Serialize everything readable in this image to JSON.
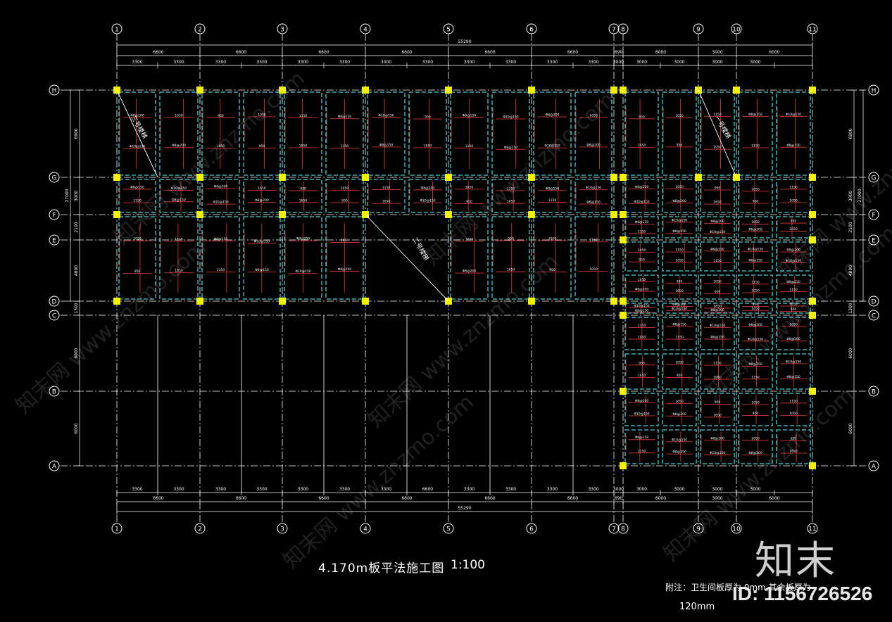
{
  "drawing": {
    "title": "4.170m板平法施工图",
    "scale": "1:100",
    "note_line1": "附注：卫生间板厚为 0mm,其余板厚为",
    "note_line2": "120mm",
    "total_length": "55290",
    "col_labels": [
      "1",
      "2",
      "3",
      "4",
      "5",
      "6",
      "7",
      "8",
      "9",
      "10",
      "11"
    ],
    "row_labels": [
      "H",
      "G",
      "F",
      "E",
      "D",
      "C",
      "B",
      "A"
    ],
    "top_spans": [
      "6600",
      "6600",
      "6600",
      "6600",
      "6600",
      "6600",
      "690",
      "6000",
      "3000",
      "6000"
    ],
    "top_sub_spans": [
      "3300",
      "3300",
      "3300",
      "3300",
      "3300",
      "3300",
      "3300",
      "3300",
      "3300",
      "3300",
      "3300",
      "3300",
      "3000",
      "3000",
      "3000",
      "3000",
      "3000"
    ],
    "bottom_spans": [
      "6600",
      "6600",
      "6600",
      "6600",
      "6600",
      "6600",
      "690",
      "6000",
      "3000",
      "6000"
    ],
    "bottom_sub_spans": [
      "3300",
      "3300",
      "3300",
      "3300",
      "3300",
      "3300",
      "3300",
      "6600",
      "3300",
      "3300",
      "3300",
      "3300",
      "3000",
      "3000",
      "3000",
      "3000",
      "3000"
    ],
    "left_dims": [
      "6900",
      "3000",
      "2100",
      "4800",
      "1300",
      "6000",
      "6000"
    ],
    "left_total": "27000",
    "right_dims": [
      "6900",
      "3000",
      "2100",
      "4800",
      "1300",
      "6000",
      "6000"
    ],
    "right_total": "27000",
    "stair_labels": [
      "三号楼梯",
      "二号楼梯",
      "一号楼梯"
    ],
    "rebar_sample": [
      "Φ8@200",
      "Φ10@150",
      "Φ8@150",
      "1150",
      "1050",
      "950",
      "1650"
    ]
  },
  "branding": {
    "logo": "知末",
    "image_id": "ID: 1156726526",
    "watermark": "知末网 www.znzmo.com"
  },
  "colors": {
    "background": "#000000",
    "grid": "#ffffff",
    "beam": "#43d1d8",
    "column": "#f2f200",
    "rebar": "#d23535",
    "dim": "#ffffff"
  }
}
